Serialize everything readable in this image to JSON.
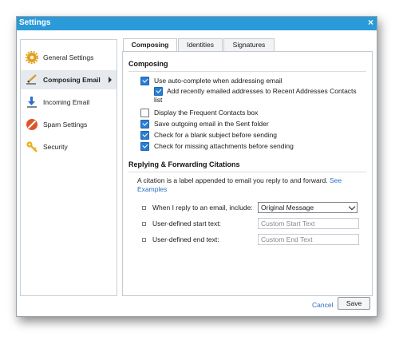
{
  "window": {
    "title": "Settings",
    "close": "×"
  },
  "sidebar": {
    "items": [
      {
        "label": "General Settings",
        "icon": "gear-icon",
        "color": "#e0a020"
      },
      {
        "label": "Composing Email",
        "icon": "compose-pencil-icon",
        "color": "#d8a030",
        "active": true
      },
      {
        "label": "Incoming Email",
        "icon": "incoming-arrow-icon",
        "color": "#2a6fd0"
      },
      {
        "label": "Spam Settings",
        "icon": "no-entry-icon",
        "color": "#e0542a"
      },
      {
        "label": "Security",
        "icon": "key-icon",
        "color": "#e8b020"
      }
    ]
  },
  "tabs": [
    {
      "label": "Composing",
      "active": true
    },
    {
      "label": "Identities"
    },
    {
      "label": "Signatures"
    }
  ],
  "composing": {
    "heading": "Composing",
    "options": [
      {
        "label": "Use auto-complete when addressing email",
        "checked": true
      },
      {
        "label": "Add recently emailed addresses to Recent Addresses Contacts",
        "label2": "list",
        "checked": true
      },
      {
        "label": "Display the Frequent Contacts box",
        "checked": false
      },
      {
        "label": "Save outgoing email in the Sent folder",
        "checked": true
      },
      {
        "label": "Check for a blank subject before sending",
        "checked": true
      },
      {
        "label": "Check for missing attachments before sending",
        "checked": true
      }
    ]
  },
  "citations": {
    "heading": "Replying & Forwarding Citations",
    "description": "A citation is a label appended to email you reply to and forward.",
    "link_part1": "See",
    "link_part2": "Examples",
    "reply_label": "When I reply to an email, include:",
    "reply_value": "Original Message",
    "start_label": "User-defined start text:",
    "start_placeholder": "Custom Start Text",
    "end_label": "User-defined end text:",
    "end_placeholder": "Custom End Text"
  },
  "footer": {
    "cancel": "Cancel",
    "save": "Save"
  },
  "colors": {
    "titlebar": "#2a9ad8",
    "checkbox": "#2a7dd1",
    "link": "#2a6fbf"
  }
}
